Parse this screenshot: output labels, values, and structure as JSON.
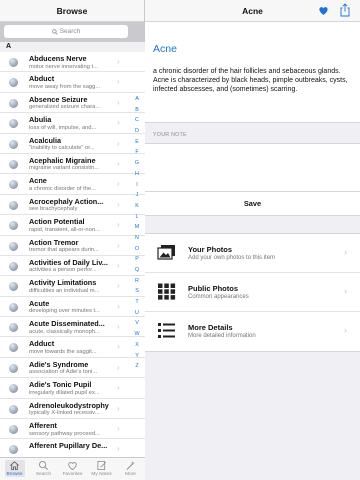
{
  "left": {
    "title": "Browse",
    "search_placeholder": "Search",
    "section": "A",
    "rows": [
      {
        "title": "Abducens Nerve",
        "subtitle": "motor nerve innervating t..."
      },
      {
        "title": "Abduct",
        "subtitle": "move away from the sagg..."
      },
      {
        "title": "Absence Seizure",
        "subtitle": "generalized seizure chara..."
      },
      {
        "title": "Abulia",
        "subtitle": "loss of will, impulse, and..."
      },
      {
        "title": "Acalculia",
        "subtitle": "\"inability to calculate\" or..."
      },
      {
        "title": "Acephalic Migraine",
        "subtitle": "migraine variant consistin..."
      },
      {
        "title": "Acne",
        "subtitle": "a chronic disorder of the..."
      },
      {
        "title": "Acrocephaly Action...",
        "subtitle": "see brachycephaly"
      },
      {
        "title": "Action Potential",
        "subtitle": "rapid, transient, all-or-non..."
      },
      {
        "title": "Action Tremor",
        "subtitle": "tremor that appears durin..."
      },
      {
        "title": "Activities of Daily Liv...",
        "subtitle": "activities a person perfor..."
      },
      {
        "title": "Activity Limitations",
        "subtitle": "difficulties an individual m..."
      },
      {
        "title": "Acute",
        "subtitle": "developing over minutes t..."
      },
      {
        "title": "Acute Disseminated...",
        "subtitle": "acute, classically monoph..."
      },
      {
        "title": "Adduct",
        "subtitle": "move towards the saggit..."
      },
      {
        "title": "Adie's Syndrome",
        "subtitle": "association of Adie's toni..."
      },
      {
        "title": "Adie's Tonic Pupil",
        "subtitle": "irregularly dilated pupil ex..."
      },
      {
        "title": "Adrenoleukodystrophy",
        "subtitle": "typically X-linked recessiv..."
      },
      {
        "title": "Afferent",
        "subtitle": "sensory pathway proceed..."
      },
      {
        "title": "Afferent Pupillary De...",
        "subtitle": ""
      }
    ],
    "index_letters": [
      "A",
      "B",
      "C",
      "D",
      "E",
      "F",
      "G",
      "H",
      "I",
      "J",
      "K",
      "L",
      "M",
      "N",
      "O",
      "P",
      "Q",
      "R",
      "S",
      "T",
      "U",
      "V",
      "W",
      "X",
      "Y",
      "Z"
    ],
    "tabs": [
      {
        "label": "Browse",
        "icon": "house-icon"
      },
      {
        "label": "Search",
        "icon": "search-icon"
      },
      {
        "label": "Favorites",
        "icon": "heart-icon"
      },
      {
        "label": "My Notes",
        "icon": "notes-icon"
      },
      {
        "label": "More",
        "icon": "wand-icon"
      }
    ]
  },
  "right": {
    "title": "Acne",
    "term": "Acne",
    "definition": "a chronic disorder of the hair follicles and sebaceous glands. Acne is characterized by black heads, pimple outbreaks, cysts, infected abscesses, and (sometimes) scarring.",
    "note_header": "YOUR NOTE",
    "note_value": "",
    "save_label": "Save",
    "menu": [
      {
        "title": "Your Photos",
        "subtitle": "Add your own photos to this item",
        "icon": "photos-icon"
      },
      {
        "title": "Public Photos",
        "subtitle": "Common appearances",
        "icon": "grid-icon"
      },
      {
        "title": "More Details",
        "subtitle": "More detailed information",
        "icon": "list-icon"
      }
    ]
  },
  "colors": {
    "accent": "#1a73d9",
    "separator": "#c8c7cc",
    "group_bg": "#efeff4"
  }
}
